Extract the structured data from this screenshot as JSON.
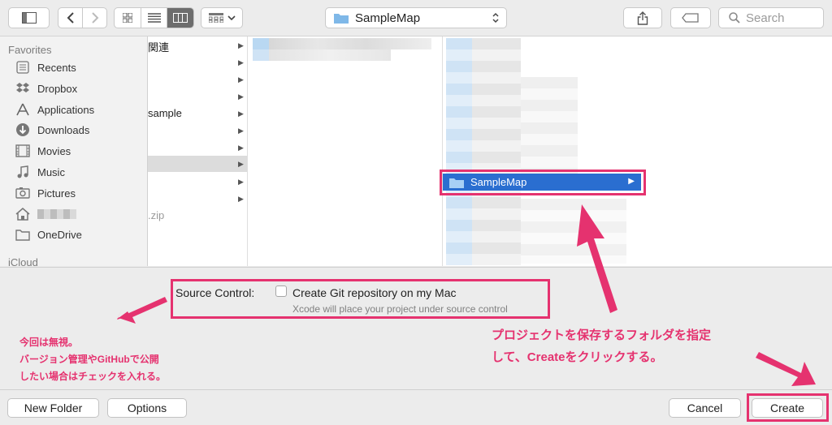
{
  "toolbar": {
    "location": "SampleMap",
    "search_placeholder": "Search"
  },
  "sidebar": {
    "favorites_header": "Favorites",
    "items": [
      {
        "label": "Recents",
        "icon": "recents-icon"
      },
      {
        "label": "Dropbox",
        "icon": "dropbox-icon"
      },
      {
        "label": "Applications",
        "icon": "applications-icon"
      },
      {
        "label": "Downloads",
        "icon": "downloads-icon"
      },
      {
        "label": "Movies",
        "icon": "movies-icon"
      },
      {
        "label": "Music",
        "icon": "music-icon"
      },
      {
        "label": "Pictures",
        "icon": "pictures-icon"
      },
      {
        "label": "",
        "icon": "home-icon"
      },
      {
        "label": "OneDrive",
        "icon": "folder-icon"
      }
    ],
    "icloud_header": "iCloud"
  },
  "browser": {
    "column1_rows": [
      "関連",
      "",
      "",
      "sample",
      "",
      "",
      "",
      "",
      "",
      ".zip"
    ],
    "selected_folder": "SampleMap"
  },
  "source_control": {
    "label": "Source Control:",
    "checkbox_label": "Create Git repository on my Mac",
    "checked": false,
    "subtext": "Xcode will place your project under source control"
  },
  "annotations": {
    "left_note": [
      "今回は無視。",
      "バージョン管理やGitHubで公開",
      "したい場合はチェックを入れる。"
    ],
    "right_note": [
      "プロジェクトを保存するフォルダを指定",
      "して、Createをクリックする。"
    ],
    "accent_color": "#e5326f"
  },
  "buttons": {
    "new_folder": "New Folder",
    "options": "Options",
    "cancel": "Cancel",
    "create": "Create"
  }
}
